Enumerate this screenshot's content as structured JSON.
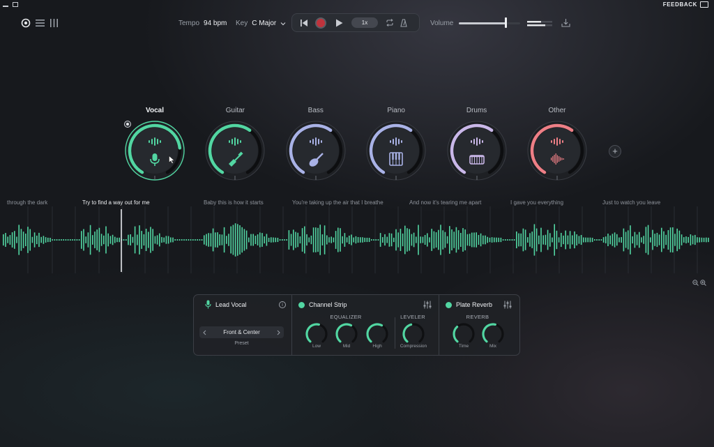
{
  "window": {
    "feedback_label": "FEEDBACK"
  },
  "toolbar": {
    "tempo_label": "Tempo",
    "tempo_value": "94 bpm",
    "key_label": "Key",
    "key_value": "C Major",
    "speed_label": "1x",
    "volume_label": "Volume",
    "volume_level": 0.78
  },
  "stems": [
    {
      "name": "Vocal",
      "color": "#52d6a2",
      "level": 0.78,
      "icon": "microphone-icon",
      "active": true
    },
    {
      "name": "Guitar",
      "color": "#52d6a2",
      "level": 0.62,
      "icon": "guitar-icon",
      "active": false
    },
    {
      "name": "Bass",
      "color": "#a9b2e6",
      "level": 0.62,
      "icon": "bass-guitar-icon",
      "active": false
    },
    {
      "name": "Piano",
      "color": "#a9b2e6",
      "level": 0.62,
      "icon": "piano-keys-icon",
      "active": false
    },
    {
      "name": "Drums",
      "color": "#c9b7e8",
      "level": 0.62,
      "icon": "drum-icon",
      "active": false
    },
    {
      "name": "Other",
      "color": "#ee7f86",
      "level": 0.62,
      "icon": "waveform-icon",
      "active": false
    }
  ],
  "lyrics": [
    {
      "text": "through the dark",
      "current": false
    },
    {
      "text": "Try to find a way out for me",
      "current": true
    },
    {
      "text": "Baby this is how it starts",
      "current": false
    },
    {
      "text": "You're taking up the air that I breathe",
      "current": false
    },
    {
      "text": "And now it's tearing me apart",
      "current": false
    },
    {
      "text": "I gave you everything",
      "current": false
    },
    {
      "text": "Just to watch you leave",
      "current": false
    }
  ],
  "waveform_color": "#52d6a2",
  "panel": {
    "track_name": "Lead Vocal",
    "preset_value": "Front & Center",
    "preset_label": "Preset",
    "channel_strip_title": "Channel Strip",
    "equalizer_label": "EQUALIZER",
    "leveler_label": "LEVELER",
    "knobs_eq": [
      {
        "label": "Low",
        "level": 0.55
      },
      {
        "label": "Mid",
        "level": 0.6
      },
      {
        "label": "High",
        "level": 0.6
      }
    ],
    "knob_leveler": {
      "label": "Compression",
      "level": 0.45
    },
    "reverb_title": "Plate Reverb",
    "reverb_label": "REVERB",
    "knobs_reverb": [
      {
        "label": "Time",
        "level": 0.35
      },
      {
        "label": "Mix",
        "level": 0.55
      }
    ],
    "accent": "#52d6a2"
  }
}
